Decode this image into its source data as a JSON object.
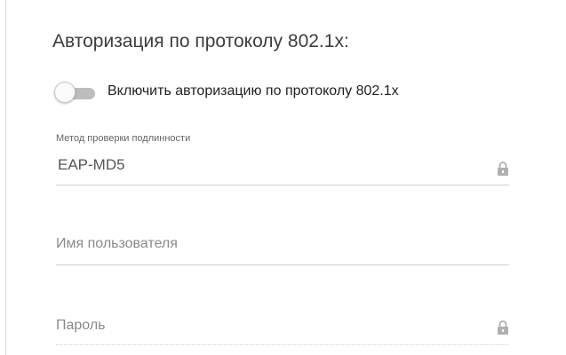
{
  "section": {
    "title": "Авторизация по протоколу 802.1x:"
  },
  "toggle": {
    "label": "Включить авторизацию по протоколу 802.1x",
    "state": "off"
  },
  "auth_method": {
    "caption": "Метод проверки подлинности",
    "value": "EAP-MD5",
    "icon": "lock-icon"
  },
  "username": {
    "placeholder": "Имя пользователя"
  },
  "password": {
    "placeholder": "Пароль",
    "icon": "lock-icon"
  },
  "colors": {
    "toggle_track_off": "#bdbdbd",
    "toggle_knob": "#fafafa",
    "underline": "#cfcfcf",
    "lock_icon": "#b0b0b0"
  }
}
